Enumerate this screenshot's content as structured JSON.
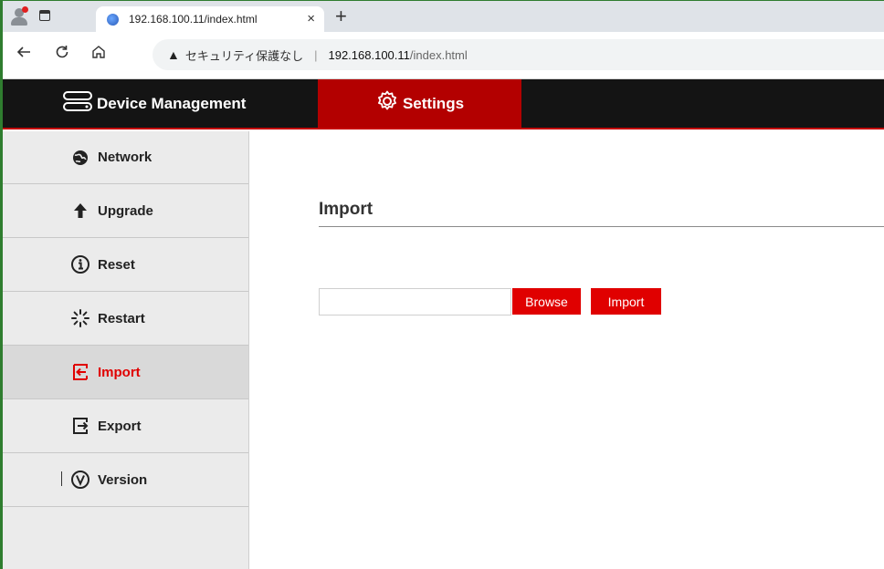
{
  "browser": {
    "tab_title": "192.168.100.11/index.html",
    "tab_close": "×",
    "new_tab": "+",
    "security_label": "セキュリティ保護なし",
    "url_separator": "|",
    "url_host": "192.168.100.11",
    "url_path": "/index.html"
  },
  "header": {
    "device_management": "Device Management",
    "settings": "Settings",
    "accent_color": "#b30000"
  },
  "sidebar": {
    "items": [
      {
        "label": "Network",
        "icon": "globe-icon"
      },
      {
        "label": "Upgrade",
        "icon": "arrow-up-icon"
      },
      {
        "label": "Reset",
        "icon": "info-icon"
      },
      {
        "label": "Restart",
        "icon": "spinner-icon"
      },
      {
        "label": "Import",
        "icon": "import-icon"
      },
      {
        "label": "Export",
        "icon": "export-icon"
      },
      {
        "label": "Version",
        "icon": "version-icon"
      }
    ],
    "active": "Import"
  },
  "main": {
    "title": "Import",
    "file_value": "",
    "browse_label": "Browse",
    "import_label": "Import"
  }
}
